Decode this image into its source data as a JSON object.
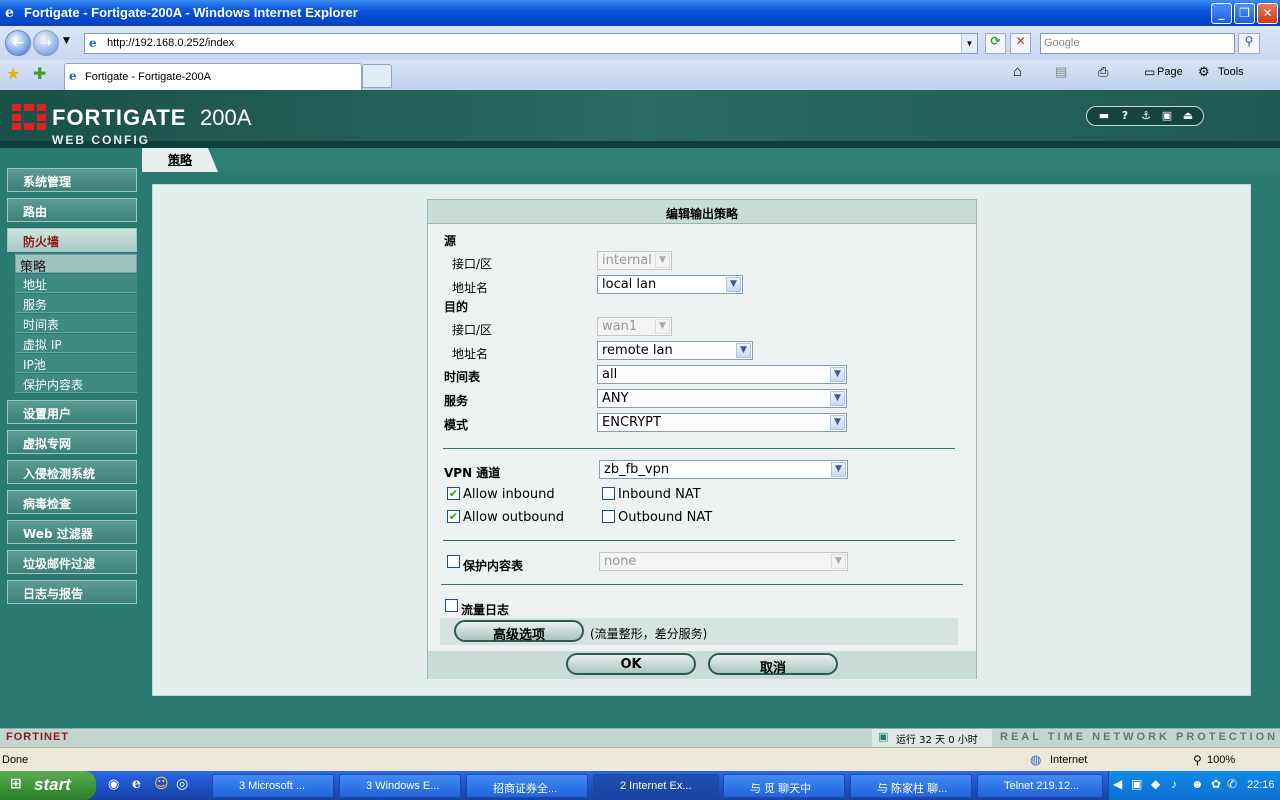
{
  "window": {
    "title": "Fortigate - Fortigate-200A - Windows Internet Explorer"
  },
  "browser": {
    "url": "http://192.168.0.252/index",
    "search_placeholder": "Google",
    "tab_title": "Fortigate - Fortigate-200A",
    "page_label": "Page",
    "tools_label": "Tools"
  },
  "header": {
    "brand": "FORTIGATE",
    "model": "200A",
    "subtitle": "WEB CONFIG"
  },
  "sidebar": {
    "items": [
      {
        "label": "系统管理"
      },
      {
        "label": "路由"
      },
      {
        "label": "防火墙"
      },
      {
        "label": "设置用户"
      },
      {
        "label": "虚拟专网"
      },
      {
        "label": "入侵检测系统"
      },
      {
        "label": "病毒检查"
      },
      {
        "label": "Web 过滤器"
      },
      {
        "label": "垃圾邮件过滤"
      },
      {
        "label": "日志与报告"
      }
    ],
    "subitems": [
      {
        "label": "策略"
      },
      {
        "label": "地址"
      },
      {
        "label": "服务"
      },
      {
        "label": "时间表"
      },
      {
        "label": "虚拟 IP"
      },
      {
        "label": "IP池"
      },
      {
        "label": "保护内容表"
      }
    ]
  },
  "page": {
    "tab": "策略"
  },
  "form": {
    "title": "编辑输出策略",
    "source_label": "源",
    "dest_label": "目的",
    "iface_label": "接口/区",
    "addr_label": "地址名",
    "src_iface": "internal",
    "src_addr": "local lan",
    "dst_iface": "wan1",
    "dst_addr": "remote lan",
    "schedule_label": "时间表",
    "schedule": "all",
    "service_label": "服务",
    "service": "ANY",
    "mode_label": "模式",
    "mode": "ENCRYPT",
    "vpn_label": "VPN 通道",
    "vpn": "zb_fb_vpn",
    "allow_inbound": "Allow inbound",
    "allow_outbound": "Allow outbound",
    "inbound_nat": "Inbound NAT",
    "outbound_nat": "Outbound NAT",
    "protection_label": "保护内容表",
    "protection": "none",
    "traffic_log": "流量日志",
    "advanced": "高级选项",
    "advanced_note": "(流量整形，差分服务)",
    "ok": "OK",
    "cancel": "取消"
  },
  "statusbar": {
    "fortinet": "FORTINET",
    "uptime": "运行 32 天 0 小时",
    "tagline": "REAL TIME NETWORK PROTECTION"
  },
  "ie_status": {
    "left": "Done",
    "zone": "Internet",
    "zoom": "100%"
  },
  "taskbar": {
    "start": "start",
    "tasks": [
      {
        "label": "3 Microsoft ..."
      },
      {
        "label": "3 Windows E..."
      },
      {
        "label": "招商证券全..."
      },
      {
        "label": "2 Internet Ex..."
      },
      {
        "label": "与 觅 聊天中"
      },
      {
        "label": "与 陈家柱 聊..."
      },
      {
        "label": "Telnet 219.12..."
      }
    ],
    "clock": "22:16"
  },
  "colors": {
    "sidebar": "#2b7a70",
    "title_bar": "#0a54d8",
    "taskbar": "#245edb",
    "start": "#3c9237"
  }
}
